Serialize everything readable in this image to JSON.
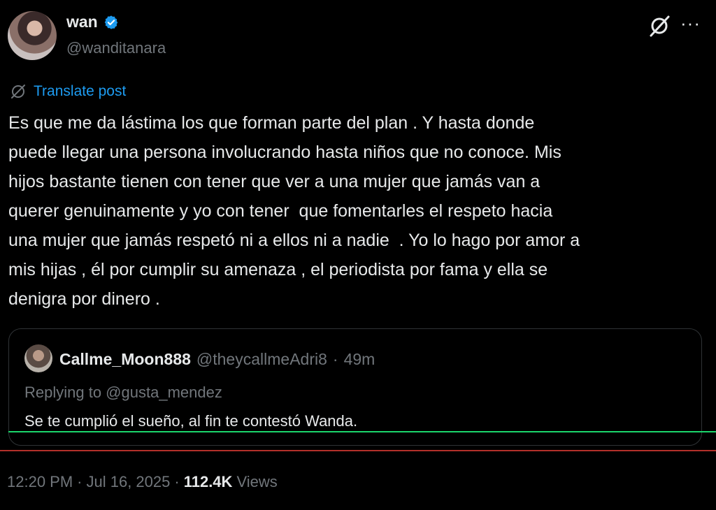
{
  "author": {
    "display_name": "wan",
    "handle": "@wanditanara"
  },
  "translate_label": "Translate post",
  "tweet_text": "Es que me da lástima los que forman parte del plan . Y hasta donde\npuede llegar una persona involucrando hasta niños que no conoce. Mis\nhijos bastante tienen con tener que ver a una mujer que jamás van a\nquerer genuinamente y yo con tener  que fomentarles el respeto hacia\nuna mujer que jamás respetó ni a ellos ni a nadie  . Yo lo hago por amor a\nmis hijas , él por cumplir su amenaza , el periodista por fama y ella se\ndenigra por dinero .",
  "quoted": {
    "name": "Callme_Moon888",
    "handle": "@theycallmeAdri8",
    "separator": "·",
    "time": "49m",
    "replying_to": "Replying to @gusta_mendez",
    "text": "Se te cumplió el sueño, al fin te contestó Wanda."
  },
  "meta": {
    "time": "12:20 PM",
    "sep1": "·",
    "date": "Jul 16, 2025",
    "sep2": "·",
    "views_count": "112.4K",
    "views_label": "Views"
  },
  "icons": {
    "verified": "verified-badge-icon",
    "grok": "grok-icon",
    "more": "more-icon",
    "translate": "globe-icon"
  },
  "colors": {
    "background": "#000000",
    "text": "#e7e9ea",
    "muted": "#71767b",
    "accent": "#1d9bf0"
  },
  "more_glyph": "···"
}
